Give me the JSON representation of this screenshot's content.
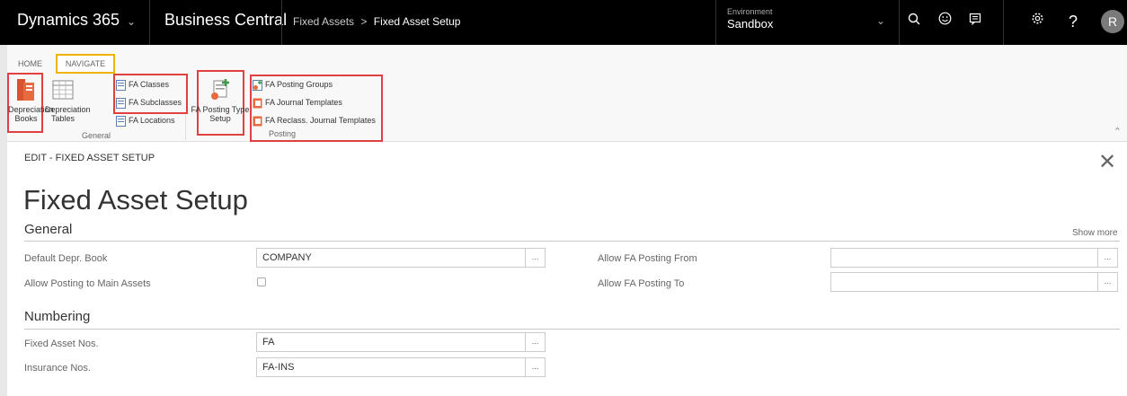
{
  "topbar": {
    "app_title": "Dynamics 365",
    "product": "Business Central",
    "breadcrumb_parent": "Fixed Assets",
    "breadcrumb_separator": ">",
    "breadcrumb_current": "Fixed Asset Setup",
    "environment_label": "Environment",
    "environment_value": "Sandbox",
    "avatar_initial": "R",
    "icons": [
      "search-icon",
      "smiley-icon",
      "chat-icon",
      "gear-icon",
      "help-icon"
    ]
  },
  "ribbon": {
    "tabs": {
      "home": "HOME",
      "navigate": "NAVIGATE"
    },
    "general": {
      "depreciation_books": [
        "Depreciation",
        "Books"
      ],
      "depreciation_tables": [
        "Depreciation",
        "Tables"
      ],
      "fa_classes": "FA Classes",
      "fa_subclasses": "FA Subclasses",
      "fa_locations": "FA Locations",
      "group_label": "General"
    },
    "posting": {
      "fa_posting_type_setup": [
        "FA Posting Type",
        "Setup"
      ],
      "fa_posting_groups": "FA Posting Groups",
      "fa_journal_templates": "FA Journal Templates",
      "fa_reclass_journal_templates": "FA Reclass. Journal Templates",
      "group_label": "Posting"
    }
  },
  "page": {
    "edit_label": "EDIT - FIXED ASSET SETUP",
    "title": "Fixed Asset Setup",
    "show_more": "Show more",
    "general": {
      "heading": "General",
      "default_depr_book_label": "Default Depr. Book",
      "default_depr_book_value": "COMPANY",
      "allow_posting_main_assets_label": "Allow Posting to Main Assets",
      "allow_posting_main_assets_checked": false,
      "allow_fa_posting_from_label": "Allow FA Posting From",
      "allow_fa_posting_from_value": "",
      "allow_fa_posting_to_label": "Allow FA Posting To",
      "allow_fa_posting_to_value": ""
    },
    "numbering": {
      "heading": "Numbering",
      "fixed_asset_nos_label": "Fixed Asset Nos.",
      "fixed_asset_nos_value": "FA",
      "insurance_nos_label": "Insurance Nos.",
      "insurance_nos_value": "FA-INS"
    },
    "lookup_label": "..."
  },
  "colors": {
    "topbar_bg": "#000000",
    "highlight_red": "#e04040",
    "highlight_yellow": "#f0b400",
    "ribbon_bg": "#f8f8f8"
  }
}
